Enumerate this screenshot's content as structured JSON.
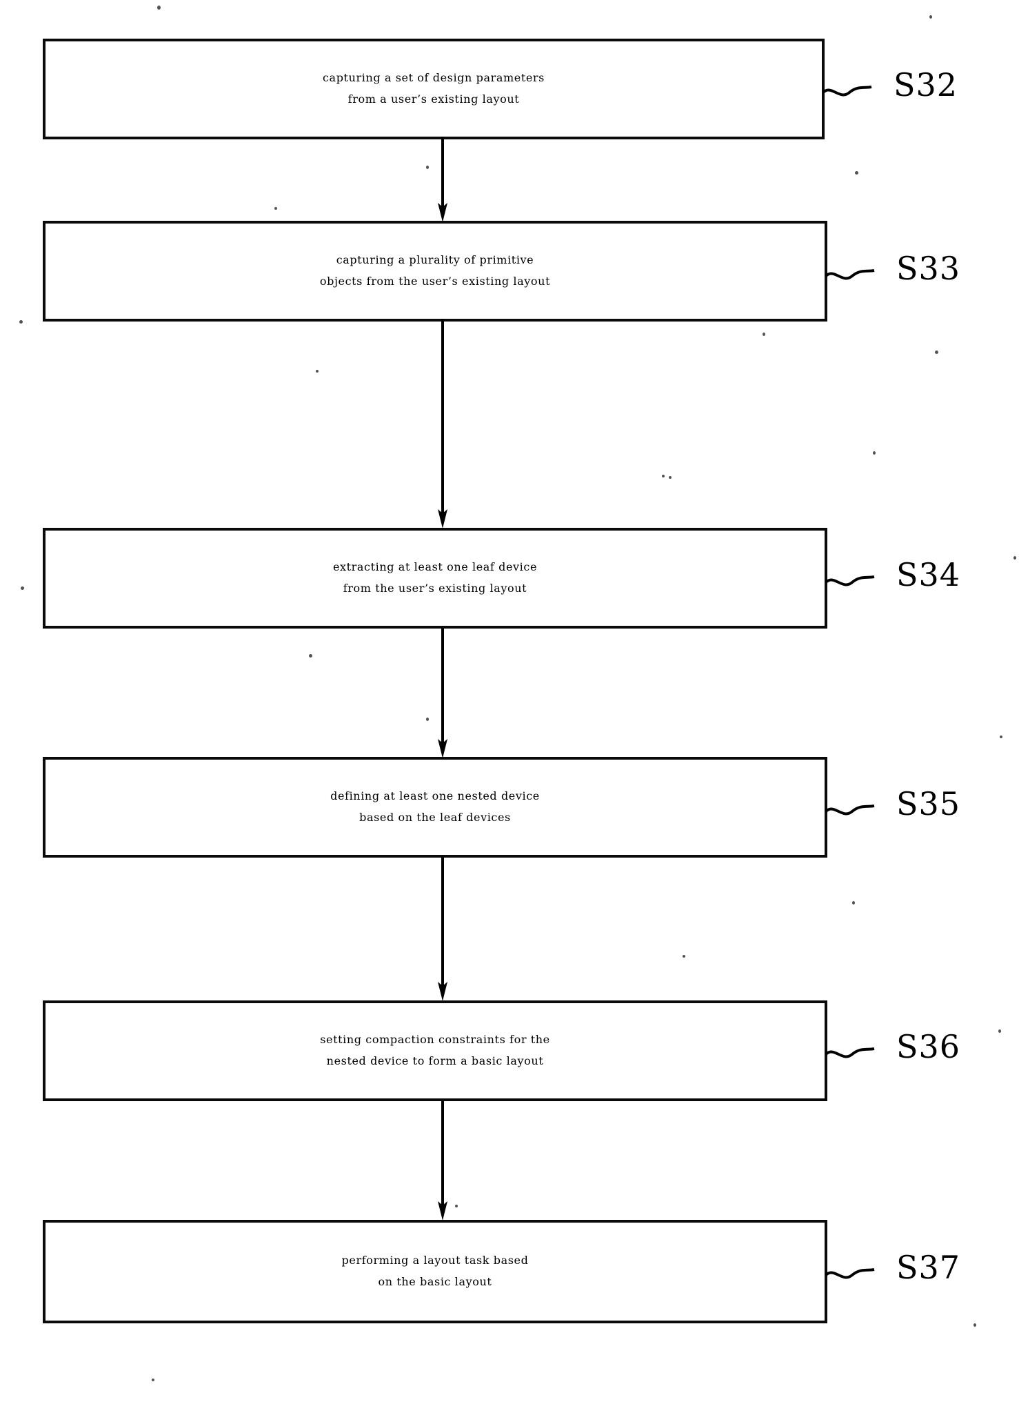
{
  "figure": {
    "type": "patent-flowchart",
    "orientation": "vertical",
    "box_count": 6
  },
  "steps": [
    {
      "ref": "S32",
      "line1": "capturing a set of design parameters",
      "line2": "from a user’s existing layout"
    },
    {
      "ref": "S33",
      "line1": "capturing a plurality of primitive",
      "line2": "objects from the user’s existing layout"
    },
    {
      "ref": "S34",
      "line1": "extracting at least one leaf device",
      "line2": "from the user’s existing layout"
    },
    {
      "ref": "S35",
      "line1": "defining at least one nested device",
      "line2": "based on the leaf devices"
    },
    {
      "ref": "S36",
      "line1": "setting compaction constraints for the",
      "line2": "nested device to form a basic layout"
    },
    {
      "ref": "S37",
      "line1": "performing a layout task based",
      "line2": "on the basic layout"
    }
  ],
  "colors": {
    "ink": "#000000",
    "paper": "#ffffff"
  }
}
